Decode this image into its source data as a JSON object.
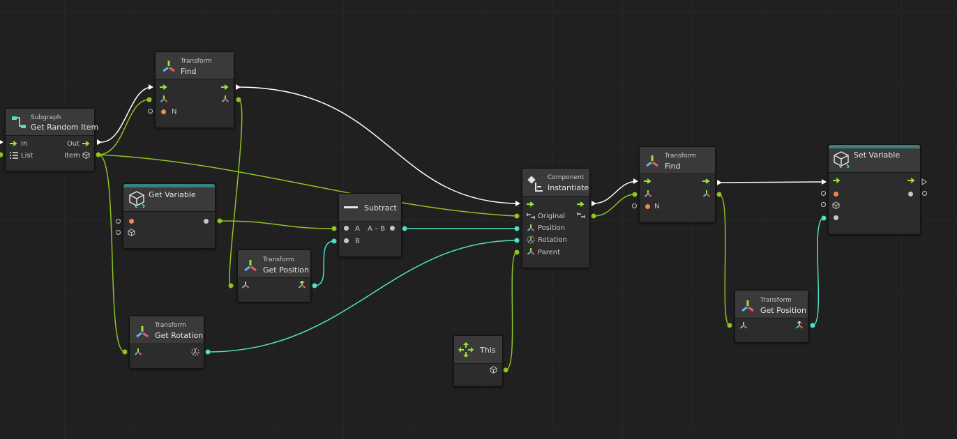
{
  "colors": {
    "background": "#202020",
    "control_flow": "#ffffff",
    "object_wire": "#8fc421",
    "vector_wire": "#4de0c4",
    "accent_green": "#9be33a",
    "header_teal": "#38817e"
  },
  "nodes": {
    "get_random_item": {
      "kind": "Subgraph",
      "title": "Get Random Item",
      "in": "In",
      "out": "Out",
      "list": "List",
      "item": "Item"
    },
    "find1": {
      "kind": "Transform",
      "title": "Find",
      "n": "N"
    },
    "get_variable": {
      "title": "Get Variable"
    },
    "subtract": {
      "title": "Subtract",
      "a": "A",
      "b": "B",
      "result": "A – B"
    },
    "get_position1": {
      "kind": "Transform",
      "title": "Get Position"
    },
    "get_rotation": {
      "kind": "Transform",
      "title": "Get Rotation"
    },
    "instantiate": {
      "kind": "Component",
      "title": "Instantiate",
      "original": "Original",
      "position": "Position",
      "rotation": "Rotation",
      "parent": "Parent"
    },
    "this": {
      "title": "This"
    },
    "find2": {
      "kind": "Transform",
      "title": "Find",
      "n": "N"
    },
    "get_position2": {
      "kind": "Transform",
      "title": "Get Position"
    },
    "set_variable": {
      "title": "Set Variable"
    }
  },
  "icons": [
    "transform-icon",
    "subgraph-icon",
    "cube-icon",
    "component-icon",
    "this-icon",
    "list-icon",
    "flow-arrow-icon",
    "minus-icon"
  ]
}
